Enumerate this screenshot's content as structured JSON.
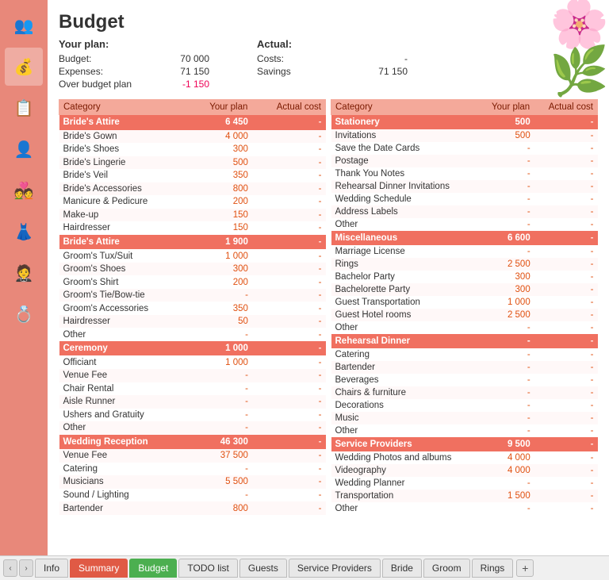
{
  "title": "Budget",
  "your_plan": {
    "label": "Your plan:",
    "rows": [
      {
        "label": "Budget:",
        "value": "70 000"
      },
      {
        "label": "Expenses:",
        "value": "71 150"
      },
      {
        "label": "Over budget plan",
        "value": "-1 150"
      }
    ]
  },
  "actual": {
    "label": "Actual:",
    "rows": [
      {
        "label": "Costs:",
        "value": "-"
      },
      {
        "label": "Savings",
        "value": "71 150"
      }
    ]
  },
  "left_table": {
    "headers": [
      "Category",
      "Your plan",
      "Actual cost"
    ],
    "sections": [
      {
        "name": "Bride's Attire",
        "total": "6 450",
        "actual": "-",
        "items": [
          {
            "name": "Bride's Gown",
            "plan": "4 000",
            "actual": "-"
          },
          {
            "name": "Bride's Shoes",
            "plan": "300",
            "actual": "-"
          },
          {
            "name": "Bride's Lingerie",
            "plan": "500",
            "actual": "-"
          },
          {
            "name": "Bride's Veil",
            "plan": "350",
            "actual": "-"
          },
          {
            "name": "Bride's Accessories",
            "plan": "800",
            "actual": "-"
          },
          {
            "name": "Manicure & Pedicure",
            "plan": "200",
            "actual": "-"
          },
          {
            "name": "Make-up",
            "plan": "150",
            "actual": "-"
          },
          {
            "name": "Hairdresser",
            "plan": "150",
            "actual": "-"
          }
        ]
      },
      {
        "name": "Bride's Attire",
        "total": "1 900",
        "actual": "-",
        "items": [
          {
            "name": "Groom's Tux/Suit",
            "plan": "1 000",
            "actual": "-"
          },
          {
            "name": "Groom's Shoes",
            "plan": "300",
            "actual": "-"
          },
          {
            "name": "Groom's Shirt",
            "plan": "200",
            "actual": "-"
          },
          {
            "name": "Groom's Tie/Bow-tie",
            "plan": "-",
            "actual": "-"
          },
          {
            "name": "Groom's Accessories",
            "plan": "350",
            "actual": "-"
          },
          {
            "name": "Hairdresser",
            "plan": "50",
            "actual": "-"
          },
          {
            "name": "Other",
            "plan": "-",
            "actual": "-"
          }
        ]
      },
      {
        "name": "Ceremony",
        "total": "1 000",
        "actual": "-",
        "items": [
          {
            "name": "Officiant",
            "plan": "1 000",
            "actual": "-"
          },
          {
            "name": "Venue Fee",
            "plan": "-",
            "actual": "-"
          },
          {
            "name": "Chair Rental",
            "plan": "-",
            "actual": "-"
          },
          {
            "name": "Aisle Runner",
            "plan": "-",
            "actual": "-"
          },
          {
            "name": "Ushers and Gratuity",
            "plan": "-",
            "actual": "-"
          },
          {
            "name": "Other",
            "plan": "-",
            "actual": "-"
          }
        ]
      },
      {
        "name": "Wedding Reception",
        "total": "46 300",
        "actual": "-",
        "items": [
          {
            "name": "Venue Fee",
            "plan": "37 500",
            "actual": "-"
          },
          {
            "name": "Catering",
            "plan": "-",
            "actual": "-"
          },
          {
            "name": "Musicians",
            "plan": "5 500",
            "actual": "-"
          },
          {
            "name": "Sound / Lighting",
            "plan": "-",
            "actual": "-"
          },
          {
            "name": "Bartender",
            "plan": "800",
            "actual": "-"
          }
        ]
      }
    ]
  },
  "right_table": {
    "headers": [
      "Category",
      "Your plan",
      "Actual cost"
    ],
    "sections": [
      {
        "name": "Stationery",
        "total": "500",
        "actual": "-",
        "items": [
          {
            "name": "Invitations",
            "plan": "500",
            "actual": "-"
          },
          {
            "name": "Save the Date Cards",
            "plan": "-",
            "actual": "-"
          },
          {
            "name": "Postage",
            "plan": "-",
            "actual": "-"
          },
          {
            "name": "Thank You Notes",
            "plan": "-",
            "actual": "-"
          },
          {
            "name": "Rehearsal Dinner Invitations",
            "plan": "-",
            "actual": "-"
          },
          {
            "name": "Wedding Schedule",
            "plan": "-",
            "actual": "-"
          },
          {
            "name": "Address Labels",
            "plan": "-",
            "actual": "-"
          },
          {
            "name": "Other",
            "plan": "-",
            "actual": "-"
          }
        ]
      },
      {
        "name": "Miscellaneous",
        "total": "6 600",
        "actual": "-",
        "items": [
          {
            "name": "Marriage License",
            "plan": "-",
            "actual": "-"
          },
          {
            "name": "Rings",
            "plan": "2 500",
            "actual": "-"
          },
          {
            "name": "Bachelor Party",
            "plan": "300",
            "actual": "-"
          },
          {
            "name": "Bachelorette Party",
            "plan": "300",
            "actual": "-"
          },
          {
            "name": "Guest Transportation",
            "plan": "1 000",
            "actual": "-"
          },
          {
            "name": "Guest Hotel rooms",
            "plan": "2 500",
            "actual": "-"
          },
          {
            "name": "Other",
            "plan": "-",
            "actual": "-"
          }
        ]
      },
      {
        "name": "Rehearsal Dinner",
        "total": "-",
        "actual": "-",
        "items": [
          {
            "name": "Catering",
            "plan": "-",
            "actual": "-"
          },
          {
            "name": "Bartender",
            "plan": "-",
            "actual": "-"
          },
          {
            "name": "Beverages",
            "plan": "-",
            "actual": "-"
          },
          {
            "name": "Chairs & furniture",
            "plan": "-",
            "actual": "-"
          },
          {
            "name": "Decorations",
            "plan": "-",
            "actual": "-"
          },
          {
            "name": "Music",
            "plan": "-",
            "actual": "-"
          },
          {
            "name": "Other",
            "plan": "-",
            "actual": "-"
          }
        ]
      },
      {
        "name": "Service Providers",
        "total": "9 500",
        "actual": "-",
        "items": [
          {
            "name": "Wedding Photos and albums",
            "plan": "4 000",
            "actual": "-"
          },
          {
            "name": "Videography",
            "plan": "4 000",
            "actual": "-"
          },
          {
            "name": "Wedding Planner",
            "plan": "-",
            "actual": "-"
          },
          {
            "name": "Transportation",
            "plan": "1 500",
            "actual": "-"
          },
          {
            "name": "Other",
            "plan": "-",
            "actual": "-"
          }
        ]
      }
    ]
  },
  "sidebar": {
    "icons": [
      "👥",
      "💰",
      "📋",
      "👤",
      "💑",
      "👗",
      "🤵",
      "💍"
    ]
  },
  "bottom_tabs": {
    "nav_prev": "<",
    "nav_next": ">",
    "tabs": [
      {
        "label": "Info",
        "type": "normal"
      },
      {
        "label": "Summary",
        "type": "summary"
      },
      {
        "label": "Budget",
        "type": "active"
      },
      {
        "label": "TODO list",
        "type": "normal"
      },
      {
        "label": "Guests",
        "type": "normal"
      },
      {
        "label": "Service Providers",
        "type": "normal"
      },
      {
        "label": "Bride",
        "type": "normal"
      },
      {
        "label": "Groom",
        "type": "normal"
      },
      {
        "label": "Rings",
        "type": "normal"
      }
    ],
    "add_label": "+"
  }
}
